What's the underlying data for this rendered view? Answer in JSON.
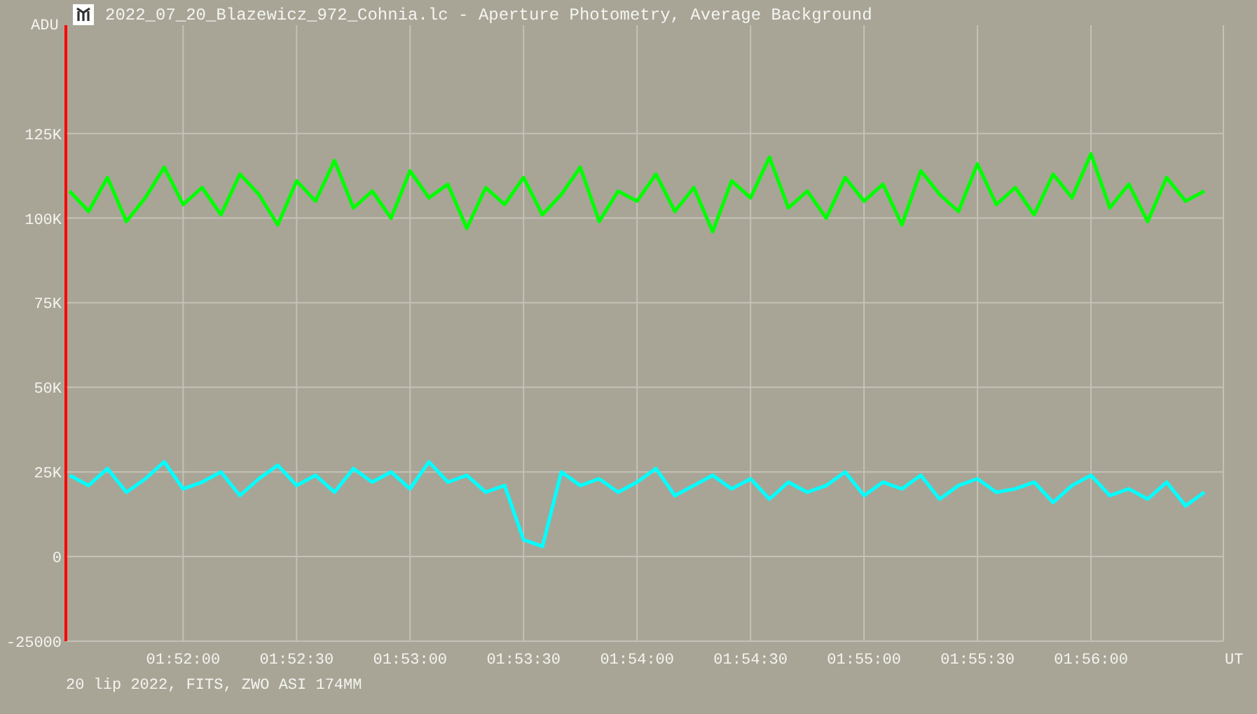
{
  "window": {
    "title": "2022_07_20_Blazewicz_972_Cohnia.lc - Aperture Photometry, Average Background"
  },
  "chart": {
    "chart_data": {
      "type": "line",
      "xlabel": "UT",
      "ylabel": "ADU",
      "categories": [
        null,
        null,
        null,
        null,
        null,
        null,
        "01:52:00",
        null,
        null,
        null,
        null,
        null,
        "01:52:30",
        null,
        null,
        null,
        null,
        null,
        "01:53:00",
        null,
        null,
        null,
        null,
        null,
        "01:53:30",
        null,
        null,
        null,
        null,
        null,
        "01:54:00",
        null,
        null,
        null,
        null,
        null,
        "01:54:30",
        null,
        null,
        null,
        null,
        null,
        "01:55:00",
        null,
        null,
        null,
        null,
        null,
        "01:55:30",
        null,
        null,
        null,
        null,
        null,
        "01:56:00",
        null,
        null,
        null,
        null,
        null,
        null
      ],
      "ylim": [
        -25000,
        157000
      ],
      "grid": true,
      "yticks": [
        {
          "value": -25000,
          "label": "-25000"
        },
        {
          "value": 0,
          "label": "0"
        },
        {
          "value": 25000,
          "label": "25K"
        },
        {
          "value": 50000,
          "label": "50K"
        },
        {
          "value": 75000,
          "label": "75K"
        },
        {
          "value": 100000,
          "label": "100K"
        },
        {
          "value": 125000,
          "label": "125K"
        }
      ],
      "series": [
        {
          "color": "#00ff00",
          "values": [
            108000,
            102000,
            112000,
            99000,
            106000,
            115000,
            104000,
            109000,
            101000,
            113000,
            107000,
            98000,
            111000,
            105000,
            117000,
            103000,
            108000,
            100000,
            114000,
            106000,
            110000,
            97000,
            109000,
            104000,
            112000,
            101000,
            107000,
            115000,
            99000,
            108000,
            105000,
            113000,
            102000,
            109000,
            96000,
            111000,
            106000,
            118000,
            103000,
            108000,
            100000,
            112000,
            105000,
            110000,
            98000,
            114000,
            107000,
            102000,
            116000,
            104000,
            109000,
            101000,
            113000,
            106000,
            119000,
            103000,
            110000,
            99000,
            112000,
            105000,
            108000
          ]
        },
        {
          "color": "#00ffff",
          "values": [
            24000,
            21000,
            26000,
            19000,
            23000,
            28000,
            20000,
            22000,
            25000,
            18000,
            23000,
            27000,
            21000,
            24000,
            19000,
            26000,
            22000,
            25000,
            20000,
            28000,
            22000,
            24000,
            19000,
            21000,
            5000,
            3000,
            25000,
            21000,
            23000,
            19000,
            22000,
            26000,
            18000,
            21000,
            24000,
            20000,
            23000,
            17000,
            22000,
            19000,
            21000,
            25000,
            18000,
            22000,
            20000,
            24000,
            17000,
            21000,
            23000,
            19000,
            20000,
            22000,
            16000,
            21000,
            24000,
            18000,
            20000,
            17000,
            22000,
            15000,
            19000
          ]
        }
      ]
    }
  },
  "status_bar": {
    "text": "20 lip 2022, FITS, ZWO ASI 174MM"
  }
}
